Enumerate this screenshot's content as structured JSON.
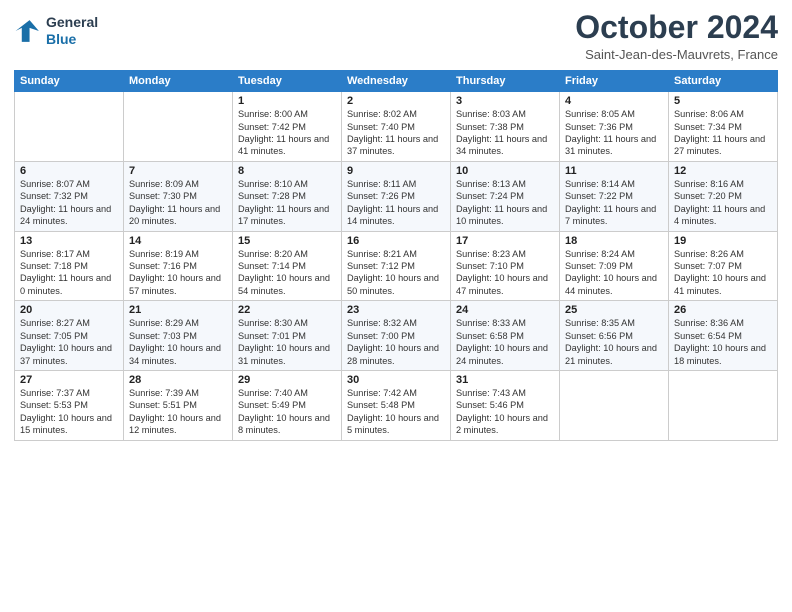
{
  "header": {
    "logo_line1": "General",
    "logo_line2": "Blue",
    "month": "October 2024",
    "location": "Saint-Jean-des-Mauvrets, France"
  },
  "weekdays": [
    "Sunday",
    "Monday",
    "Tuesday",
    "Wednesday",
    "Thursday",
    "Friday",
    "Saturday"
  ],
  "rows": [
    [
      {
        "day": "",
        "text": ""
      },
      {
        "day": "",
        "text": ""
      },
      {
        "day": "1",
        "text": "Sunrise: 8:00 AM\nSunset: 7:42 PM\nDaylight: 11 hours and 41 minutes."
      },
      {
        "day": "2",
        "text": "Sunrise: 8:02 AM\nSunset: 7:40 PM\nDaylight: 11 hours and 37 minutes."
      },
      {
        "day": "3",
        "text": "Sunrise: 8:03 AM\nSunset: 7:38 PM\nDaylight: 11 hours and 34 minutes."
      },
      {
        "day": "4",
        "text": "Sunrise: 8:05 AM\nSunset: 7:36 PM\nDaylight: 11 hours and 31 minutes."
      },
      {
        "day": "5",
        "text": "Sunrise: 8:06 AM\nSunset: 7:34 PM\nDaylight: 11 hours and 27 minutes."
      }
    ],
    [
      {
        "day": "6",
        "text": "Sunrise: 8:07 AM\nSunset: 7:32 PM\nDaylight: 11 hours and 24 minutes."
      },
      {
        "day": "7",
        "text": "Sunrise: 8:09 AM\nSunset: 7:30 PM\nDaylight: 11 hours and 20 minutes."
      },
      {
        "day": "8",
        "text": "Sunrise: 8:10 AM\nSunset: 7:28 PM\nDaylight: 11 hours and 17 minutes."
      },
      {
        "day": "9",
        "text": "Sunrise: 8:11 AM\nSunset: 7:26 PM\nDaylight: 11 hours and 14 minutes."
      },
      {
        "day": "10",
        "text": "Sunrise: 8:13 AM\nSunset: 7:24 PM\nDaylight: 11 hours and 10 minutes."
      },
      {
        "day": "11",
        "text": "Sunrise: 8:14 AM\nSunset: 7:22 PM\nDaylight: 11 hours and 7 minutes."
      },
      {
        "day": "12",
        "text": "Sunrise: 8:16 AM\nSunset: 7:20 PM\nDaylight: 11 hours and 4 minutes."
      }
    ],
    [
      {
        "day": "13",
        "text": "Sunrise: 8:17 AM\nSunset: 7:18 PM\nDaylight: 11 hours and 0 minutes."
      },
      {
        "day": "14",
        "text": "Sunrise: 8:19 AM\nSunset: 7:16 PM\nDaylight: 10 hours and 57 minutes."
      },
      {
        "day": "15",
        "text": "Sunrise: 8:20 AM\nSunset: 7:14 PM\nDaylight: 10 hours and 54 minutes."
      },
      {
        "day": "16",
        "text": "Sunrise: 8:21 AM\nSunset: 7:12 PM\nDaylight: 10 hours and 50 minutes."
      },
      {
        "day": "17",
        "text": "Sunrise: 8:23 AM\nSunset: 7:10 PM\nDaylight: 10 hours and 47 minutes."
      },
      {
        "day": "18",
        "text": "Sunrise: 8:24 AM\nSunset: 7:09 PM\nDaylight: 10 hours and 44 minutes."
      },
      {
        "day": "19",
        "text": "Sunrise: 8:26 AM\nSunset: 7:07 PM\nDaylight: 10 hours and 41 minutes."
      }
    ],
    [
      {
        "day": "20",
        "text": "Sunrise: 8:27 AM\nSunset: 7:05 PM\nDaylight: 10 hours and 37 minutes."
      },
      {
        "day": "21",
        "text": "Sunrise: 8:29 AM\nSunset: 7:03 PM\nDaylight: 10 hours and 34 minutes."
      },
      {
        "day": "22",
        "text": "Sunrise: 8:30 AM\nSunset: 7:01 PM\nDaylight: 10 hours and 31 minutes."
      },
      {
        "day": "23",
        "text": "Sunrise: 8:32 AM\nSunset: 7:00 PM\nDaylight: 10 hours and 28 minutes."
      },
      {
        "day": "24",
        "text": "Sunrise: 8:33 AM\nSunset: 6:58 PM\nDaylight: 10 hours and 24 minutes."
      },
      {
        "day": "25",
        "text": "Sunrise: 8:35 AM\nSunset: 6:56 PM\nDaylight: 10 hours and 21 minutes."
      },
      {
        "day": "26",
        "text": "Sunrise: 8:36 AM\nSunset: 6:54 PM\nDaylight: 10 hours and 18 minutes."
      }
    ],
    [
      {
        "day": "27",
        "text": "Sunrise: 7:37 AM\nSunset: 5:53 PM\nDaylight: 10 hours and 15 minutes."
      },
      {
        "day": "28",
        "text": "Sunrise: 7:39 AM\nSunset: 5:51 PM\nDaylight: 10 hours and 12 minutes."
      },
      {
        "day": "29",
        "text": "Sunrise: 7:40 AM\nSunset: 5:49 PM\nDaylight: 10 hours and 8 minutes."
      },
      {
        "day": "30",
        "text": "Sunrise: 7:42 AM\nSunset: 5:48 PM\nDaylight: 10 hours and 5 minutes."
      },
      {
        "day": "31",
        "text": "Sunrise: 7:43 AM\nSunset: 5:46 PM\nDaylight: 10 hours and 2 minutes."
      },
      {
        "day": "",
        "text": ""
      },
      {
        "day": "",
        "text": ""
      }
    ]
  ]
}
